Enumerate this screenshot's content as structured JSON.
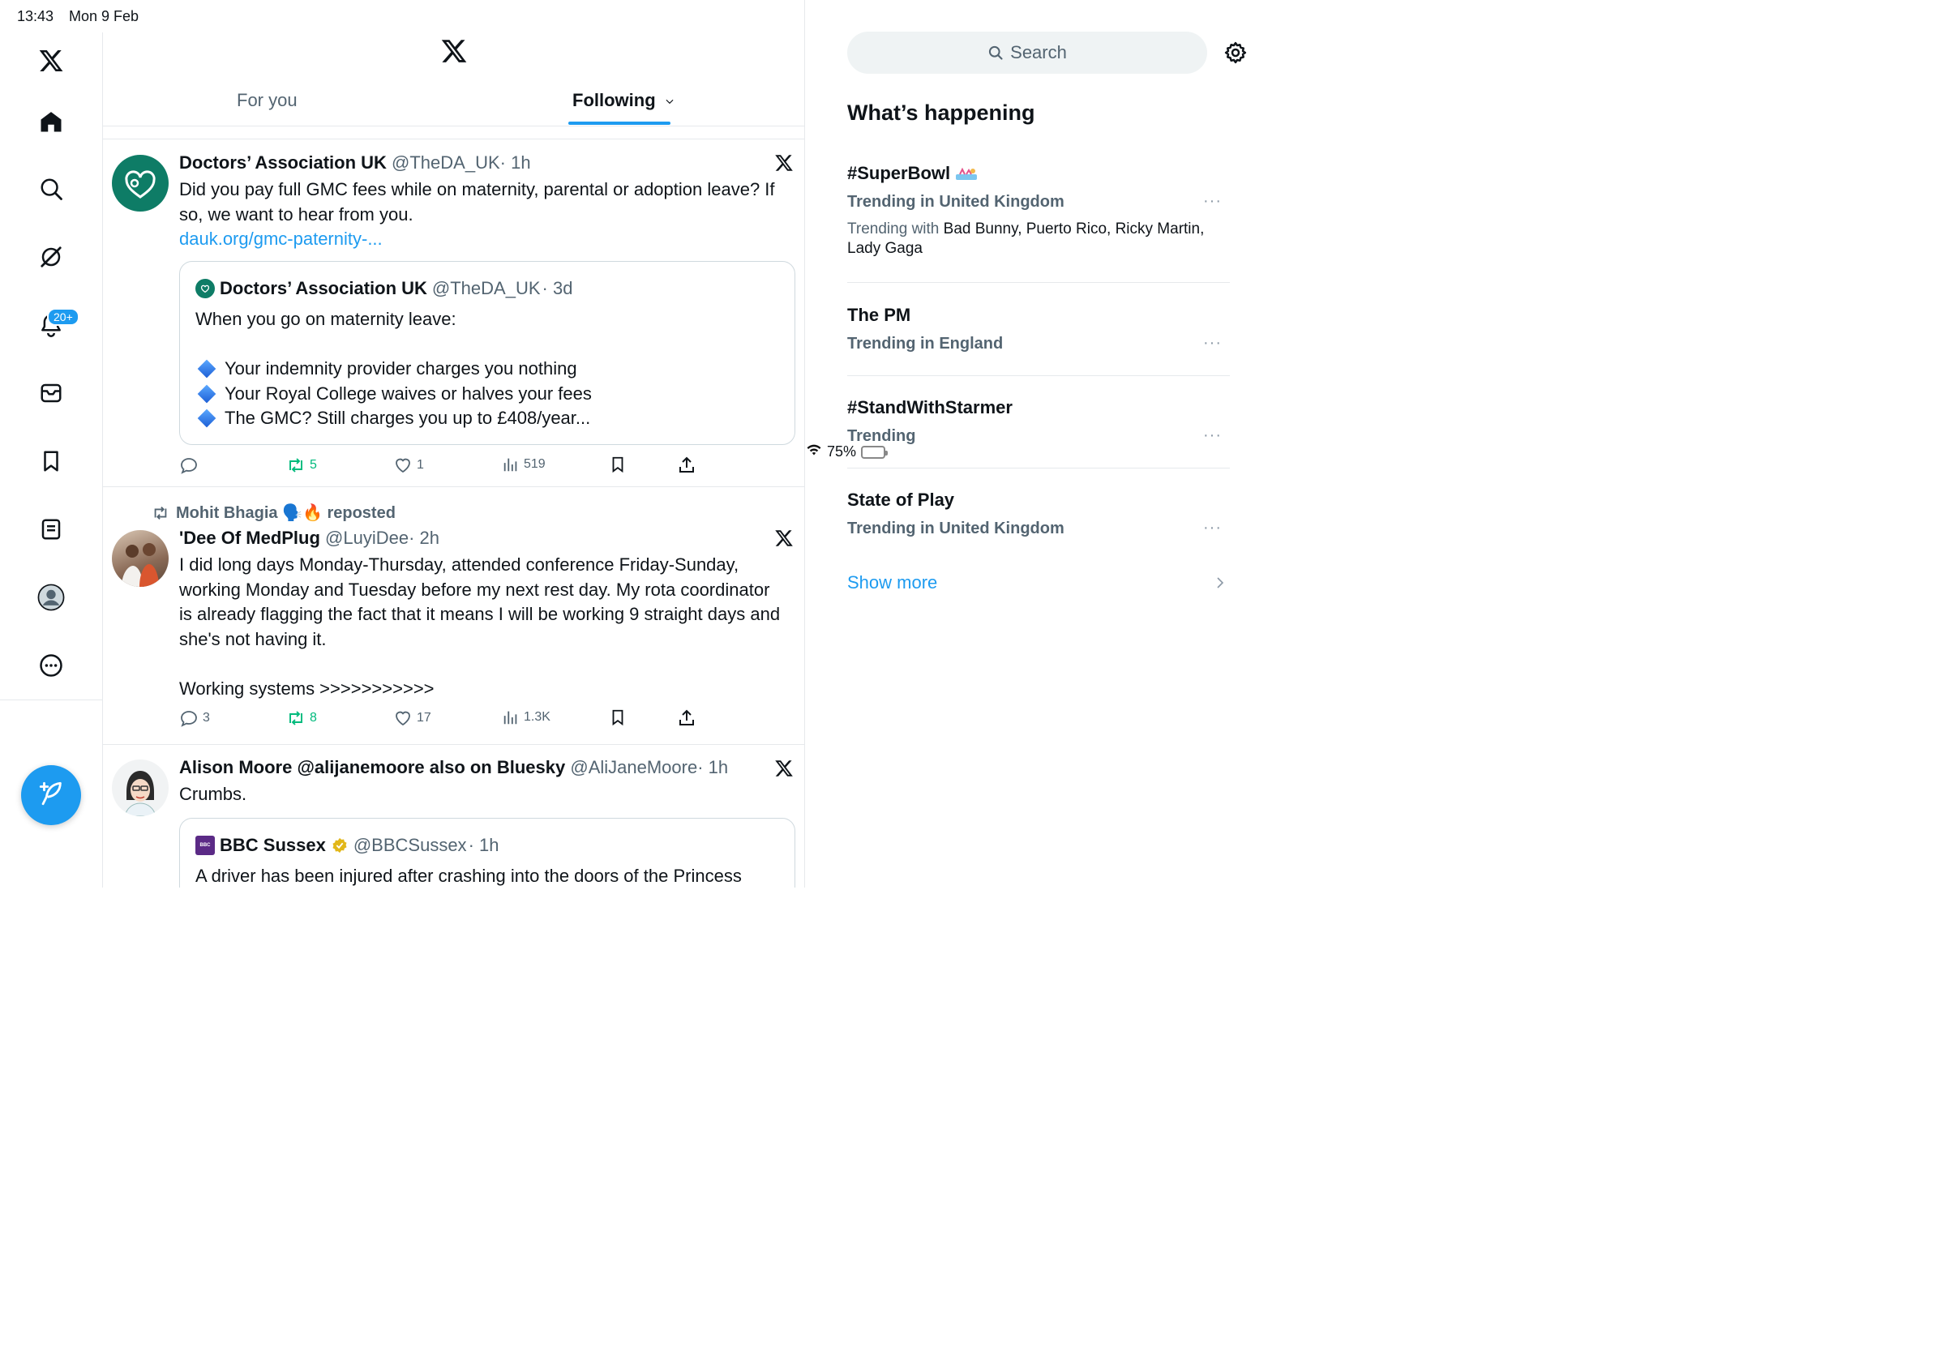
{
  "status_bar": {
    "time": "13:43",
    "date": "Mon 9 Feb",
    "battery": "75%",
    "battery_fill": 0.75
  },
  "nav": {
    "notifications_badge": "20+"
  },
  "tabs": {
    "for_you": "For you",
    "following": "Following"
  },
  "tweets": [
    {
      "name": "Doctors’ Association UK",
      "handle": "@TheDA_UK",
      "time": "· 1h",
      "text_line1": "Did you pay full GMC fees while on maternity, parental or adoption leave? If",
      "text_line2": "so, we want to hear from you.",
      "link": "dauk.org/gmc-paternity-...",
      "quote": {
        "name": "Doctors’ Association UK",
        "handle": "@TheDA_UK",
        "time": "· 3d",
        "line1": "When you go on maternity leave:",
        "bullets": [
          "Your indemnity provider charges you nothing",
          "Your Royal College waives or halves your fees",
          "The GMC? Still charges you up to £408/year..."
        ]
      },
      "replies": "",
      "reposts": "5",
      "likes": "1",
      "views": "519"
    },
    {
      "repost_by": "Mohit Bhagia 🗣️🔥 reposted",
      "name": "'Dee Of MedPlug",
      "handle": "@LuyiDee",
      "time": "· 2h",
      "lines": [
        "I did long days Monday-Thursday, attended conference Friday-Sunday,",
        "working Monday and Tuesday before my next rest day. My rota coordinator",
        "is already flagging the fact that it means I will be working 9 straight days and",
        "she's not having it."
      ],
      "line_last": "Working systems >>>>>>>>>>>",
      "replies": "3",
      "reposts": "8",
      "likes": "17",
      "views": "1.3K"
    },
    {
      "name": "Alison Moore @alijanemoore also on Bluesky",
      "handle": "@AliJaneMoore",
      "time": "· 1h",
      "text": "Crumbs.",
      "quote": {
        "name": "BBC Sussex",
        "handle": "@BBCSussex",
        "time": "· 1h",
        "line1": "A driver has been injured after crashing into the doors of the Princess"
      }
    }
  ],
  "sidebar": {
    "search_placeholder": "Search",
    "title": "What’s happening",
    "trends": [
      {
        "name": "#SuperBowl",
        "context": "Trending in United Kingdom",
        "with_label": "Trending with",
        "with_names": "Bad Bunny, Puerto Rico, Ricky Martin, Lady Gaga"
      },
      {
        "name": "The PM",
        "context": "Trending in England"
      },
      {
        "name": "#StandWithStarmer",
        "context": "Trending"
      },
      {
        "name": "State of Play",
        "context": "Trending in United Kingdom"
      }
    ],
    "more_glyph": "···",
    "show_more": "Show more"
  },
  "colors": {
    "accent": "#1d9bf0",
    "repost_green": "#00ba7c",
    "secondary_text": "#536471"
  }
}
